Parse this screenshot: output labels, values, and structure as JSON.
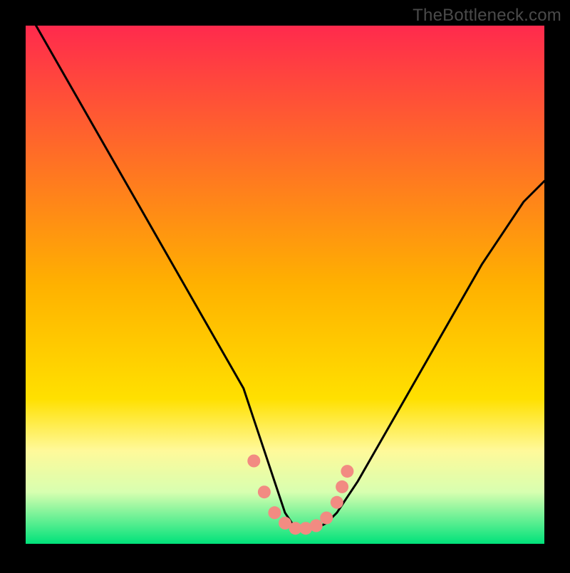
{
  "watermark": "TheBottleneck.com",
  "chart_data": {
    "type": "line",
    "title": "",
    "xlabel": "",
    "ylabel": "",
    "xlim": [
      0,
      100
    ],
    "ylim": [
      0,
      100
    ],
    "grid": false,
    "legend": false,
    "background_gradient": {
      "stops": [
        {
          "offset": 0.0,
          "color": "#ff2a4d"
        },
        {
          "offset": 0.5,
          "color": "#ffb100"
        },
        {
          "offset": 0.72,
          "color": "#ffe000"
        },
        {
          "offset": 0.82,
          "color": "#fff99a"
        },
        {
          "offset": 0.9,
          "color": "#d8ffb0"
        },
        {
          "offset": 1.0,
          "color": "#00e27a"
        }
      ]
    },
    "series": [
      {
        "name": "curve",
        "color": "#000000",
        "x": [
          2,
          6,
          10,
          14,
          18,
          22,
          26,
          30,
          34,
          38,
          42,
          44,
          46,
          48,
          50,
          52,
          54,
          56,
          58,
          60,
          64,
          68,
          72,
          76,
          80,
          84,
          88,
          92,
          96,
          100
        ],
        "y": [
          100,
          93,
          86,
          79,
          72,
          65,
          58,
          51,
          44,
          37,
          30,
          24,
          18,
          12,
          6,
          3,
          3,
          3,
          4,
          6,
          12,
          19,
          26,
          33,
          40,
          47,
          54,
          60,
          66,
          70
        ]
      }
    ],
    "markers": {
      "color": "#f28b82",
      "points": [
        {
          "x": 44,
          "y": 16
        },
        {
          "x": 46,
          "y": 10
        },
        {
          "x": 48,
          "y": 6
        },
        {
          "x": 50,
          "y": 4
        },
        {
          "x": 52,
          "y": 3
        },
        {
          "x": 54,
          "y": 3
        },
        {
          "x": 56,
          "y": 3.5
        },
        {
          "x": 58,
          "y": 5
        },
        {
          "x": 60,
          "y": 8
        },
        {
          "x": 61,
          "y": 11
        },
        {
          "x": 62,
          "y": 14
        }
      ]
    }
  }
}
